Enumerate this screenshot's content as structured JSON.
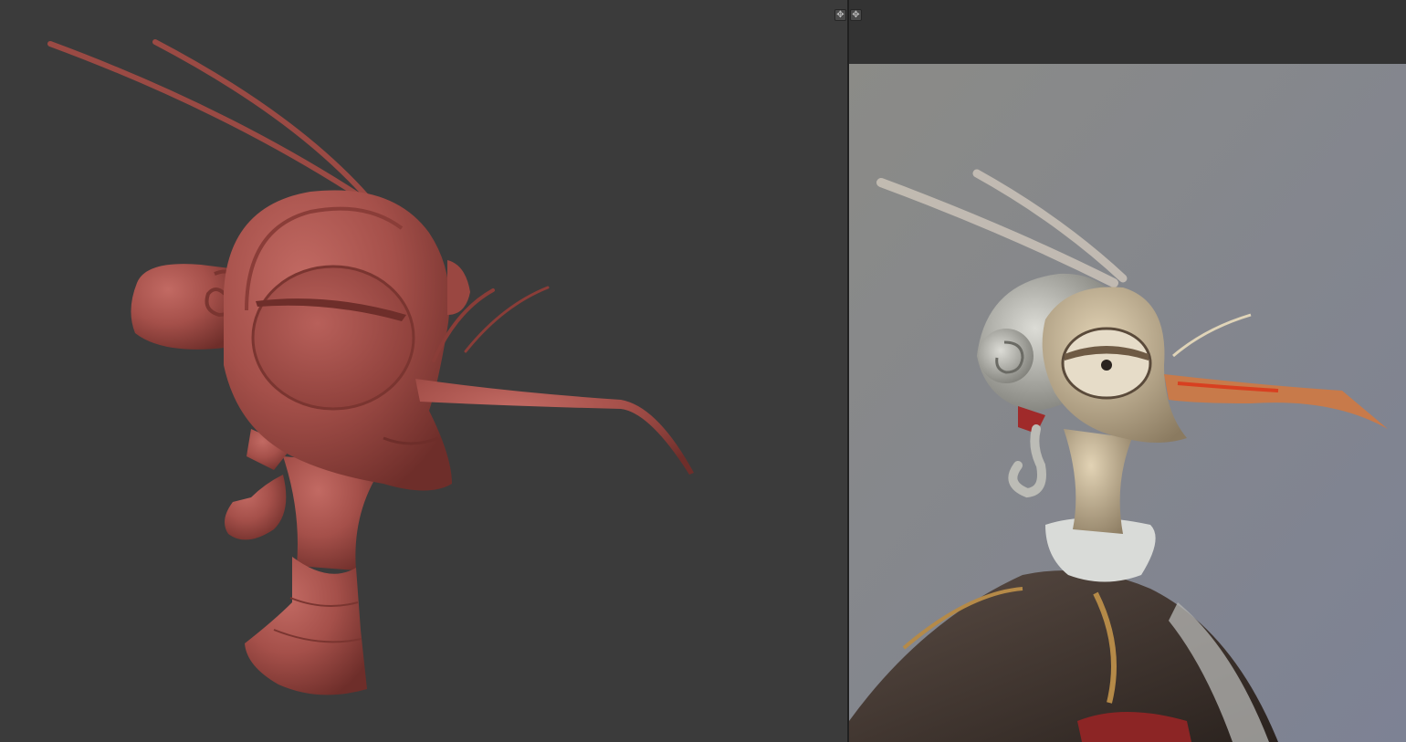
{
  "panes": {
    "left": {
      "kind": "3d-sculpt-viewport",
      "button_icon": "crosshair-icon",
      "button_glyph": "✥",
      "background": "#3b3b3b",
      "model_color": "#a5504a"
    },
    "right": {
      "kind": "reference-image-viewer",
      "button_icon": "crosshair-icon",
      "button_glyph": "✥",
      "topbar_color": "#333333",
      "canvas_color": "#8a8a86"
    }
  }
}
